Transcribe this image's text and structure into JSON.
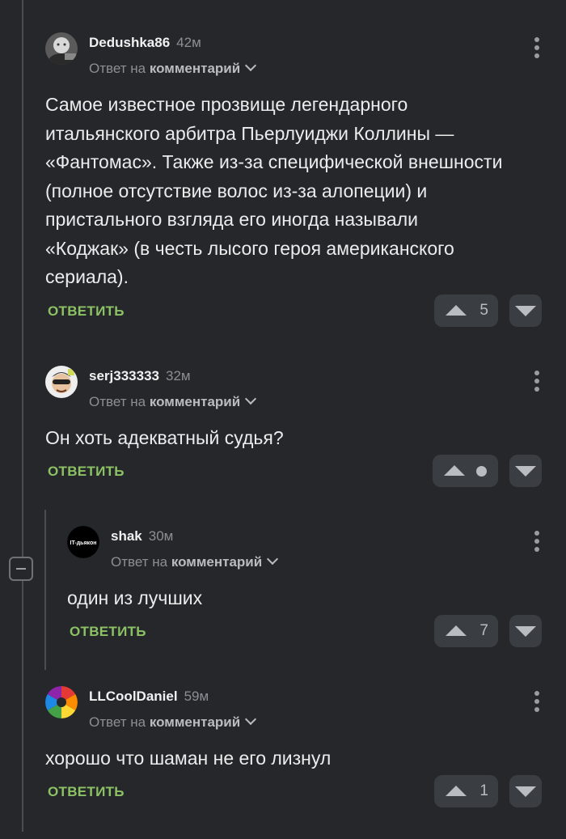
{
  "reply_prefix": "Ответ на",
  "reply_target": "комментарий",
  "reply_button": "ОТВЕТИТЬ",
  "comments": [
    {
      "author": "Dedushka86",
      "time": "42м",
      "text": "Самое известное прозвище легендарного\nитальянского арбитра Пьерлуиджи Коллины —\n«Фантомас». Также из-за специфической внешности\n(полное отсутствие волос из-за алопеции) и\nпристального взгляда его иногда называли\n«Коджак» (в честь лысого героя американского\nсериала).",
      "score": "5",
      "avatar": "bald-man-photo"
    },
    {
      "author": "serj333333",
      "time": "32м",
      "text": "Он хоть адекватный судья?",
      "score": "",
      "score_indicator": "dot",
      "avatar": "cartoon-man-with-sunglasses"
    },
    {
      "author": "shak",
      "time": "30м",
      "text": "один из лучших",
      "score": "7",
      "avatar": "black-circle-logo",
      "avatar_text": "IT-дьякон"
    },
    {
      "author": "LLCoolDaniel",
      "time": "59м",
      "text": "хорошо что шаман не его лизнул",
      "score": "1",
      "avatar": "rainbow-circle"
    }
  ],
  "colors": {
    "background": "#25272b",
    "reply_green": "#8cc264",
    "vote_button": "#3a3d42"
  }
}
